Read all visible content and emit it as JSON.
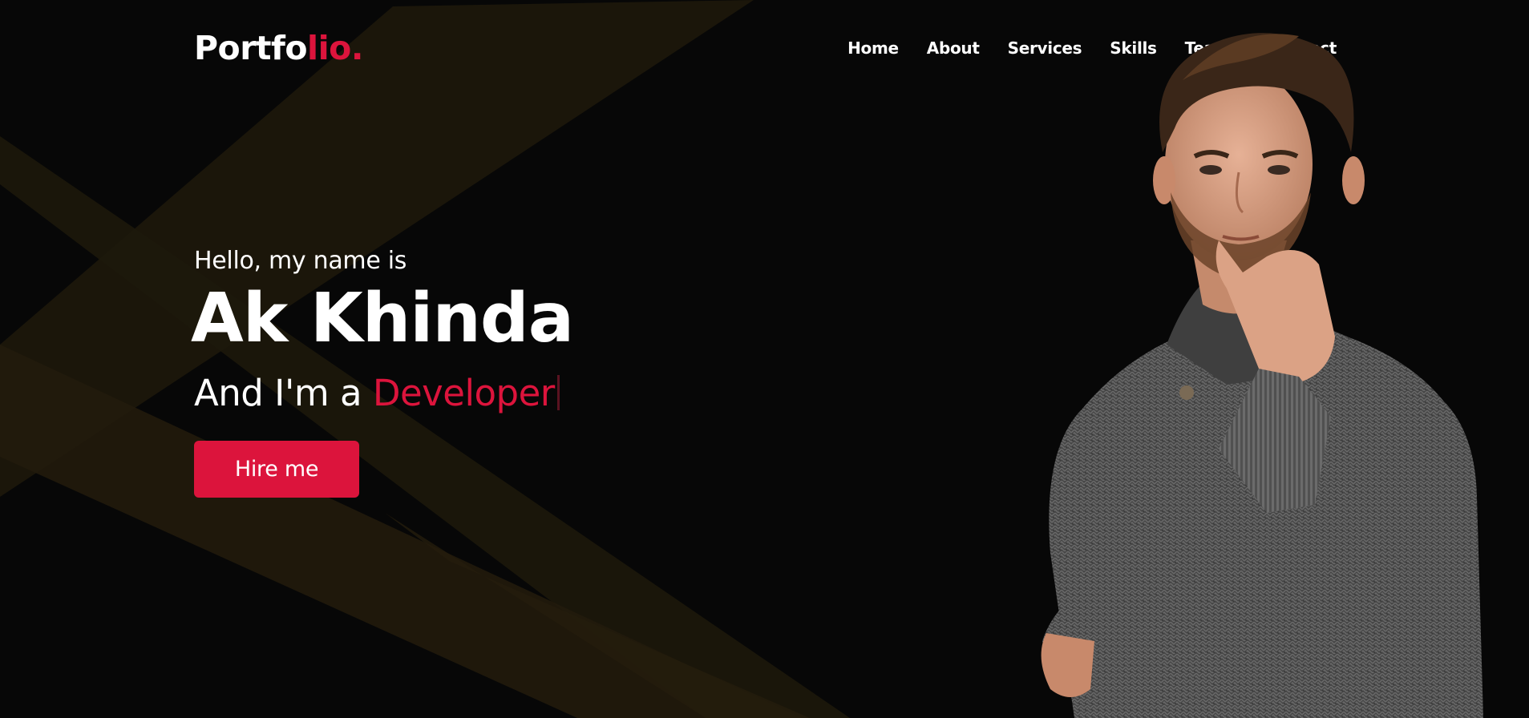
{
  "header": {
    "logo_main": "Portfo",
    "logo_accent": "lio."
  },
  "nav": {
    "items": [
      {
        "label": "Home"
      },
      {
        "label": "About"
      },
      {
        "label": "Services"
      },
      {
        "label": "Skills"
      },
      {
        "label": "Teams"
      },
      {
        "label": "Contact"
      }
    ]
  },
  "hero": {
    "greeting": "Hello, my name is",
    "name": "Ak Khinda",
    "role_prefix": "And I'm a ",
    "role_typed": "Developer",
    "cta_label": "Hire me"
  },
  "colors": {
    "background": "#070707",
    "accent": "#dc143c",
    "text": "#ffffff",
    "ray": "#2a2210",
    "sweater": "#4a4a4a"
  },
  "images": {
    "hero_photo": "portrait-man-in-knit-sweater"
  }
}
